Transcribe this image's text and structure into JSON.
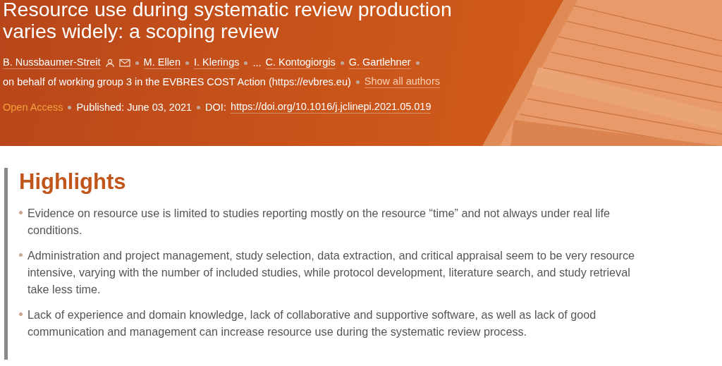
{
  "header": {
    "title_lines": [
      "Resource use during systematic review production",
      "varies widely: a scoping review"
    ],
    "authors": [
      {
        "kind": "contact_author",
        "name": "B. Nussbaumer-Streit"
      },
      {
        "kind": "author",
        "name": "M. Ellen"
      },
      {
        "kind": "author",
        "name": "I. Klerings"
      },
      {
        "kind": "ellipsis",
        "name": "..."
      },
      {
        "kind": "author",
        "name": "C. Kontogiorgis"
      },
      {
        "kind": "author",
        "name": "G. Gartlehner"
      }
    ],
    "group": "on behalf of working group 3 in the EVBRES COST Action (https://evbres.eu)",
    "show_all": "Show all authors",
    "access": "Open Access",
    "published": "Published: June 03, 2021",
    "doi_label": "DOI:",
    "doi_link": "https://doi.org/10.1016/j.jclinepi.2021.05.019",
    "image": {
      "kind": "picture"
    }
  },
  "highlights": {
    "heading": "Highlights",
    "items": [
      "Evidence on resource use is limited to studies reporting mostly on the resource “time” and not always under real life conditions.",
      "Administration and project management, study selection, data extraction, and critical appraisal seem to be very resource intensive, varying with the number of included studies, while protocol development, literature search, and study retrieval take less time.",
      "Lack of experience and domain knowledge, lack of collaborative and supportive software, as well as lack of good communication and management can increase resource use during the systematic review process."
    ]
  }
}
